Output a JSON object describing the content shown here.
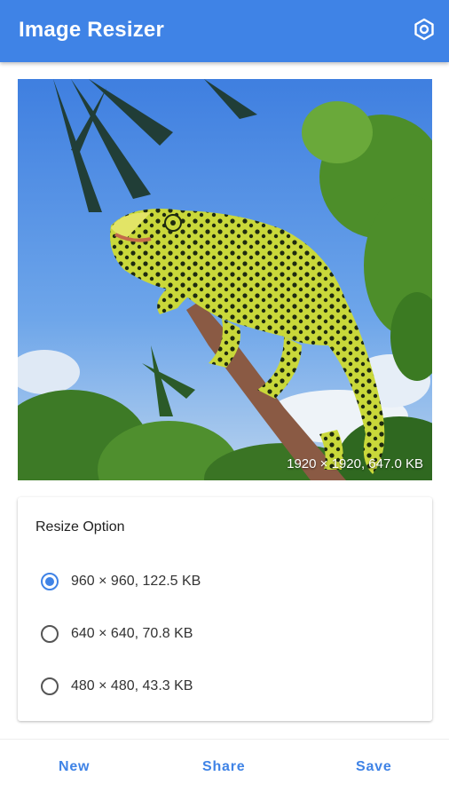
{
  "app_bar": {
    "title": "Image Resizer",
    "settings_icon": "settings-hexagon-icon",
    "color": "#3f83e6"
  },
  "preview": {
    "info": "1920 × 1920,  647.0 KB"
  },
  "resize_option": {
    "title": "Resize Option",
    "options": [
      {
        "label": "960 × 960,  122.5 KB",
        "selected": true
      },
      {
        "label": "640 × 640,  70.8 KB",
        "selected": false
      },
      {
        "label": "480 × 480,  43.3 KB",
        "selected": false
      }
    ]
  },
  "bottom_bar": {
    "new_label": "New",
    "share_label": "Share",
    "save_label": "Save"
  }
}
